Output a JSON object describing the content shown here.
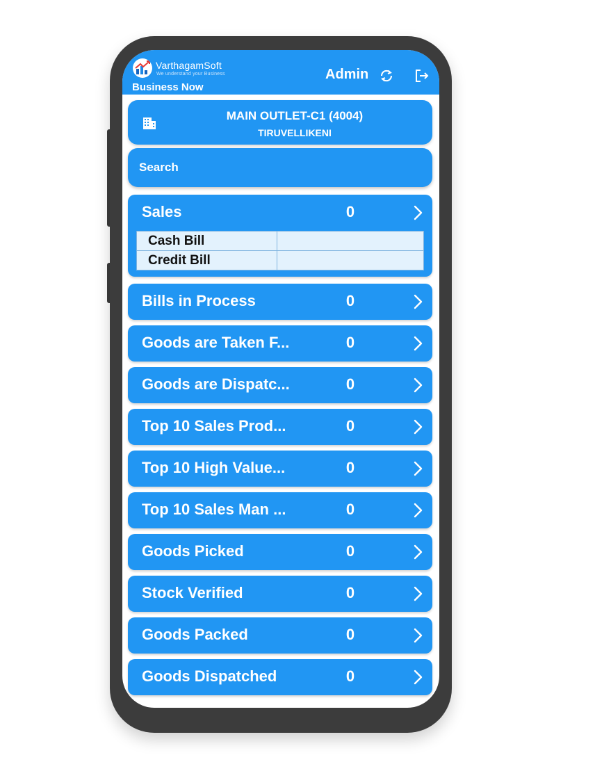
{
  "header": {
    "brand_name": "VarthagamSoft",
    "brand_tagline": "We understand your Business",
    "app_name": "Business Now",
    "user_name": "Admin",
    "refresh_icon": "refresh-icon",
    "logout_icon": "logout-icon"
  },
  "outlet": {
    "icon": "building-icon",
    "title": "MAIN OUTLET-C1 (4004)",
    "location": "TIRUVELLIKENI"
  },
  "search": {
    "placeholder": "Search",
    "value": ""
  },
  "items": [
    {
      "label": "Sales",
      "count": "0",
      "expanded": true,
      "sub_rows": [
        {
          "label": "Cash Bill",
          "value": ""
        },
        {
          "label": "Credit Bill",
          "value": ""
        }
      ]
    },
    {
      "label": "Bills in Process",
      "count": "0"
    },
    {
      "label": "Goods are Taken F...",
      "count": "0"
    },
    {
      "label": "Goods are Dispatc...",
      "count": "0"
    },
    {
      "label": "Top 10 Sales Prod...",
      "count": "0"
    },
    {
      "label": "Top 10 High Value...",
      "count": "0"
    },
    {
      "label": "Top 10 Sales Man ...",
      "count": "0"
    },
    {
      "label": "Goods Picked",
      "count": "0"
    },
    {
      "label": "Stock Verified",
      "count": "0"
    },
    {
      "label": "Goods Packed",
      "count": "0"
    },
    {
      "label": "Goods Dispatched",
      "count": "0"
    }
  ],
  "colors": {
    "primary": "#2196f3",
    "frame": "#3c3c3c",
    "table_bg": "#e3f2fd"
  }
}
